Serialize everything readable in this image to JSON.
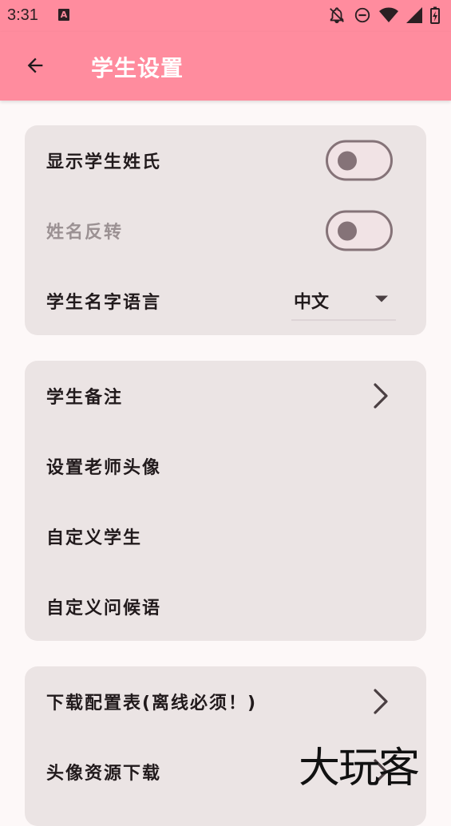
{
  "status_bar": {
    "time": "3:31",
    "a_badge": "A",
    "icons": [
      "notification-off-icon",
      "do-not-disturb-icon",
      "wifi-icon",
      "cell-signal-icon",
      "battery-charging-icon"
    ]
  },
  "app_bar": {
    "title": "学生设置",
    "back_icon": "arrow-back-icon",
    "color": "#ff8c9e"
  },
  "card1": {
    "show_surname": {
      "label": "显示学生姓氏",
      "on": false
    },
    "name_reverse": {
      "label": "姓名反转",
      "on": false,
      "enabled": false
    },
    "name_language": {
      "label": "学生名字语言",
      "selected": "中文"
    }
  },
  "card2": {
    "items": [
      {
        "label": "学生备注",
        "chevron": true
      },
      {
        "label": "设置老师头像",
        "chevron": false
      },
      {
        "label": "自定义学生",
        "chevron": false
      },
      {
        "label": "自定义问候语",
        "chevron": false
      }
    ]
  },
  "card3": {
    "items": [
      {
        "label": "下载配置表(离线必须！)",
        "chevron": true
      },
      {
        "label": "头像资源下载",
        "chevron": true
      }
    ]
  },
  "watermark": "大玩客"
}
